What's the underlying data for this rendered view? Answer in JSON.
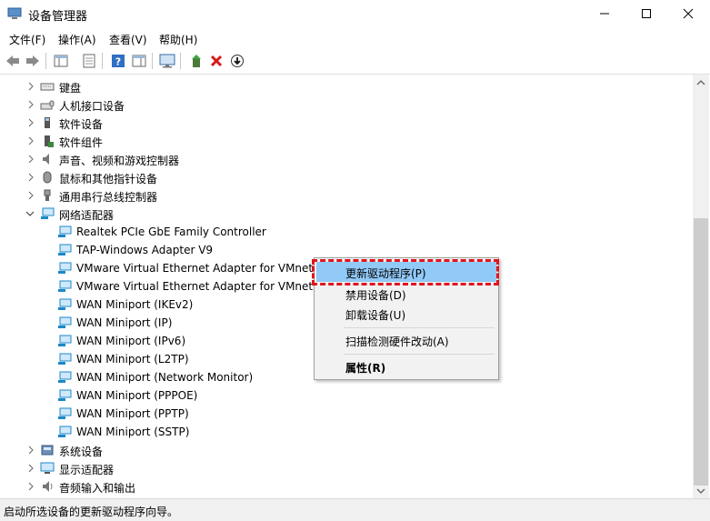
{
  "window": {
    "title": "设备管理器",
    "minimize": "─",
    "maximize": "☐",
    "close": "✕"
  },
  "menu": [
    "文件(F)",
    "操作(A)",
    "查看(V)",
    "帮助(H)"
  ],
  "toolbar": {
    "icons": [
      "back-arrow-icon",
      "forward-arrow-icon",
      "properties-icon",
      "console-tree-icon",
      "help-icon",
      "action-pane-icon",
      "scan-monitor-icon",
      "update-driver-icon",
      "uninstall-x-icon",
      "download-driver-icon"
    ]
  },
  "tree": {
    "categories_top": [
      "键盘",
      "人机接口设备",
      "软件设备",
      "软件组件",
      "声音、视频和游戏控制器",
      "鼠标和其他指针设备",
      "通用串行总线控制器",
      "网络适配器"
    ],
    "adapters": [
      "Realtek PCIe GbE Family Controller",
      "TAP-Windows Adapter V9",
      "VMware Virtual Ethernet Adapter for VMnet",
      "VMware Virtual Ethernet Adapter for VMnet8",
      "WAN Miniport (IKEv2)",
      "WAN Miniport (IP)",
      "WAN Miniport (IPv6)",
      "WAN Miniport (L2TP)",
      "WAN Miniport (Network Monitor)",
      "WAN Miniport (PPPOE)",
      "WAN Miniport (PPTP)",
      "WAN Miniport (SSTP)"
    ],
    "categories_bottom": [
      "系统设备",
      "显示适配器",
      "音频输入和输出"
    ]
  },
  "context_menu": {
    "update_driver": "更新驱动程序(P)",
    "disable_device": "禁用设备(D)",
    "uninstall_device": "卸载设备(U)",
    "scan_hardware": "扫描检测硬件改动(A)",
    "properties": "属性(R)"
  },
  "status_bar": "启动所选设备的更新驱动程序向导。",
  "colors": {
    "highlight": "#91c9f7",
    "callout": "#e0141e",
    "network": "#1e88c8"
  }
}
